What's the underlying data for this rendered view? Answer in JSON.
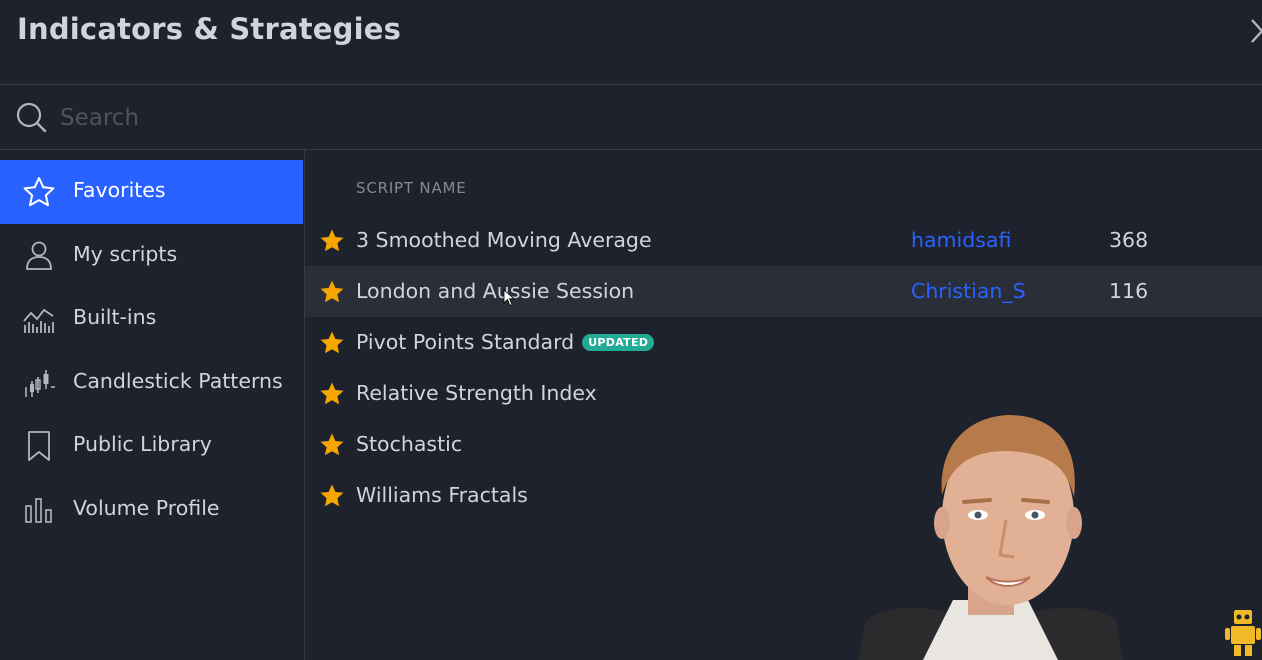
{
  "header": {
    "title": "Indicators & Strategies"
  },
  "search": {
    "placeholder": "Search",
    "value": ""
  },
  "sidebar": {
    "items": [
      {
        "label": "Favorites",
        "icon": "star-outline-icon",
        "active": true
      },
      {
        "label": "My scripts",
        "icon": "user-icon"
      },
      {
        "label": "Built-ins",
        "icon": "chart-icon"
      },
      {
        "label": "Candlestick Patterns",
        "icon": "candlestick-icon"
      },
      {
        "label": "Public Library",
        "icon": "bookmark-icon"
      },
      {
        "label": "Volume Profile",
        "icon": "volume-profile-icon"
      }
    ]
  },
  "list": {
    "column_header": "SCRIPT NAME",
    "rows": [
      {
        "name": "3 Smoothed Moving Average",
        "author": "hamidsafi",
        "count": "368"
      },
      {
        "name": "London and Aussie Session",
        "author": "Christian_S",
        "count": "116"
      },
      {
        "name": "Pivot Points Standard",
        "badge": "UPDATED"
      },
      {
        "name": "Relative Strength Index"
      },
      {
        "name": "Stochastic"
      },
      {
        "name": "Williams Fractals"
      }
    ]
  },
  "colors": {
    "background": "#1e222d",
    "accent": "#2962ff",
    "star": "#f7a600",
    "badge": "#22ab94",
    "row_hover": "#2a2e39"
  }
}
